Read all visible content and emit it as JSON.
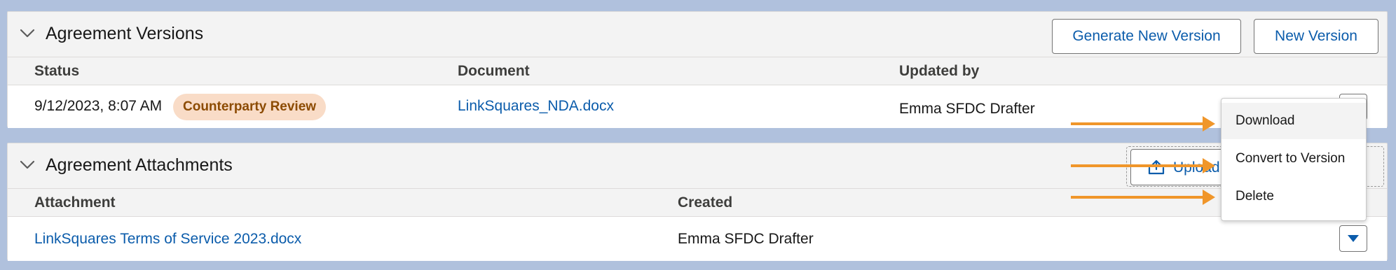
{
  "versions": {
    "title": "Agreement Versions",
    "generate_button": "Generate New Version",
    "new_button": "New Version",
    "columns": {
      "status": "Status",
      "document": "Document",
      "updated_by": "Updated by"
    },
    "row": {
      "date": "9/12/2023, 8:07 AM",
      "status_badge": "Counterparty Review",
      "document": "LinkSquares_NDA.docx",
      "updated_by": "Emma SFDC Drafter"
    }
  },
  "attachments": {
    "title": "Agreement Attachments",
    "upload_button": "Upload",
    "columns": {
      "attachment": "Attachment",
      "created": "Created"
    },
    "row": {
      "attachment": "LinkSquares Terms of Service 2023.docx",
      "created": "Emma SFDC Drafter"
    }
  },
  "dropdown": {
    "items": [
      "Download",
      "Convert to Version",
      "Delete"
    ]
  },
  "colors": {
    "accent_link": "#0b5cab",
    "annotation_arrow": "#f0962a",
    "badge_bg": "#f9dcc7",
    "badge_text": "#8c4b02"
  }
}
